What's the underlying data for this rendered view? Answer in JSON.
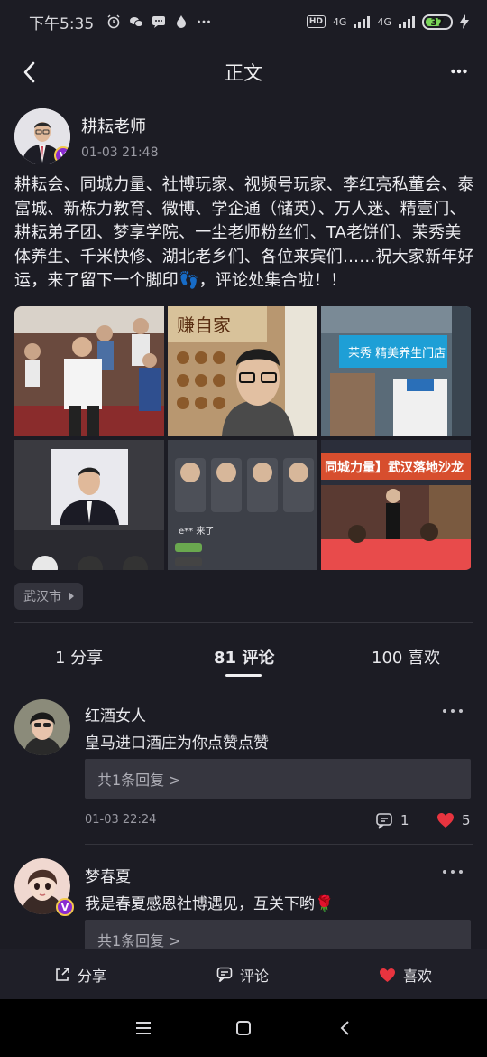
{
  "status": {
    "time": "下午5:35",
    "hd": "HD",
    "net1": "4G",
    "net2": "4G",
    "battery": "37"
  },
  "nav": {
    "title": "正文"
  },
  "author": {
    "name": "耕耘老师",
    "time": "01-03 21:48",
    "badge": "V"
  },
  "post": {
    "text": "耕耘会、同城力量、社博玩家、视频号玩家、李红亮私董会、泰富城、新栋力教育、微博、学企通（储英）、万人迷、精壹门、耕耘弟子团、梦享学院、一尘老师粉丝们、TA老饼们、茉秀美体养生、千米快修、湖北老乡们、各位来宾们……祝大家新年好运，来了留下一个脚印👣，评论处集合啦！！",
    "photos": [
      {
        "alt": "event-photo",
        "text": ""
      },
      {
        "alt": "selfie-photo",
        "text": "赚自家"
      },
      {
        "alt": "storefront-photo",
        "text": "茉秀 精美养生门店"
      },
      {
        "alt": "portrait-photo",
        "text": ""
      },
      {
        "alt": "livestream-screenshot",
        "text": "e** 来了"
      },
      {
        "alt": "salon-photo",
        "text": "同城力量】武汉落地沙龙"
      }
    ],
    "location": "武汉市"
  },
  "stats": {
    "shares": "1 分享",
    "comments": "81 评论",
    "likes": "100 喜欢"
  },
  "comments": [
    {
      "name": "红酒女人",
      "text": "皇马进口酒庄为你点赞点赞",
      "reply": "共1条回复 >",
      "time": "01-03 22:24",
      "reply_count": "1",
      "like_count": "5"
    },
    {
      "name": "梦春夏",
      "text": "我是春夏感恩社博遇见，互关下哟🌹",
      "reply": "共1条回复 >",
      "badge": "V"
    }
  ],
  "bottom_bar": {
    "share": "分享",
    "comment": "评论",
    "like": "喜欢"
  },
  "colors": {
    "background": "#1c1c24",
    "like_red": "#e8343f",
    "badge_purple": "#8a2bd1",
    "battery_green": "#7bd65a"
  }
}
